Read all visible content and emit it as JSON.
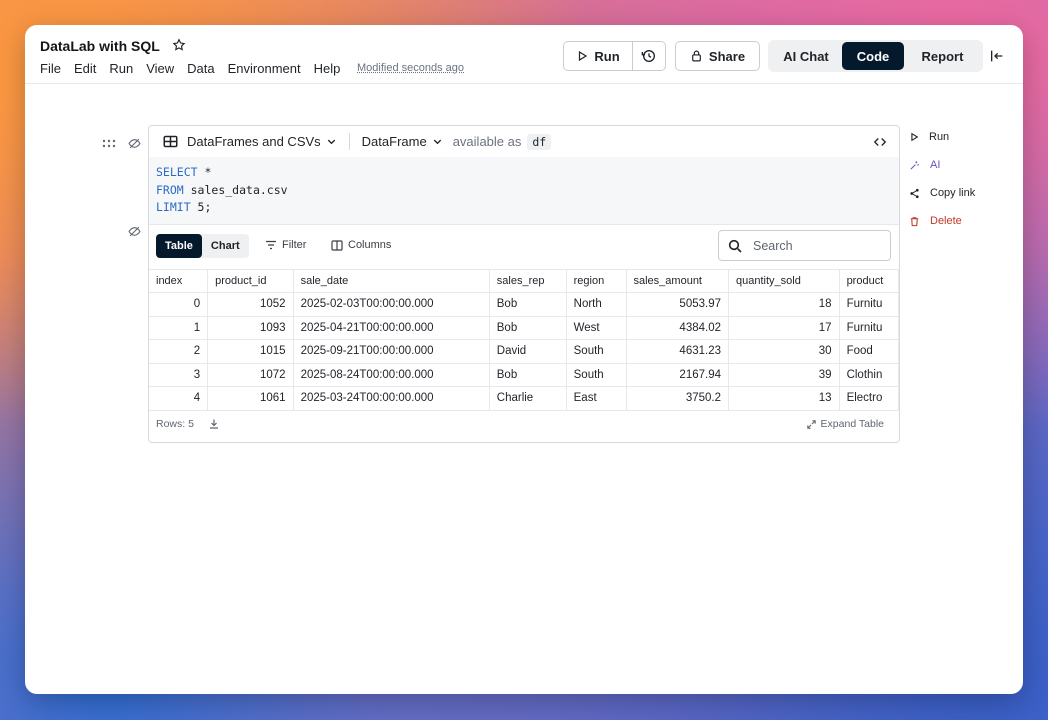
{
  "app": {
    "title": "DataLab with SQL",
    "modified": "Modified seconds ago"
  },
  "menu": [
    "File",
    "Edit",
    "Run",
    "View",
    "Data",
    "Environment",
    "Help"
  ],
  "toolbar": {
    "run": "Run",
    "share": "Share",
    "tabs": [
      "AI Chat",
      "Code",
      "Report"
    ],
    "active_tab": "Code"
  },
  "cell": {
    "source": "DataFrames and CSVs",
    "output_type": "DataFrame",
    "available_as": "available as",
    "var": "df",
    "code": {
      "l1_kw": "SELECT",
      "l1_rest": " *",
      "l2_kw": "FROM",
      "l2_rest": " sales_data.csv",
      "l3_kw": "LIMIT",
      "l3_rest": " 5;"
    },
    "result_tabs": [
      "Table",
      "Chart"
    ],
    "filter": "Filter",
    "columns": "Columns",
    "search_placeholder": "Search",
    "rows_label": "Rows: 5",
    "expand": "Expand Table"
  },
  "side_actions": {
    "run": "Run",
    "ai": "AI",
    "copy_link": "Copy link",
    "delete": "Delete"
  },
  "table": {
    "headers": [
      "index",
      "product_id",
      "sale_date",
      "sales_rep",
      "region",
      "sales_amount",
      "quantity_sold",
      "product"
    ],
    "rows": [
      [
        "0",
        "1052",
        "2025-02-03T00:00:00.000",
        "Bob",
        "North",
        "5053.97",
        "18",
        "Furnitu"
      ],
      [
        "1",
        "1093",
        "2025-04-21T00:00:00.000",
        "Bob",
        "West",
        "4384.02",
        "17",
        "Furnitu"
      ],
      [
        "2",
        "1015",
        "2025-09-21T00:00:00.000",
        "David",
        "South",
        "4631.23",
        "30",
        "Food"
      ],
      [
        "3",
        "1072",
        "2025-08-24T00:00:00.000",
        "Bob",
        "South",
        "2167.94",
        "39",
        "Clothin"
      ],
      [
        "4",
        "1061",
        "2025-03-24T00:00:00.000",
        "Charlie",
        "East",
        "3750.2",
        "13",
        "Electro"
      ]
    ]
  },
  "colors": {
    "accent_dark": "#05192d",
    "keyword": "#2b6cc4",
    "delete": "#c0392b",
    "ai": "#6b4fbb"
  }
}
